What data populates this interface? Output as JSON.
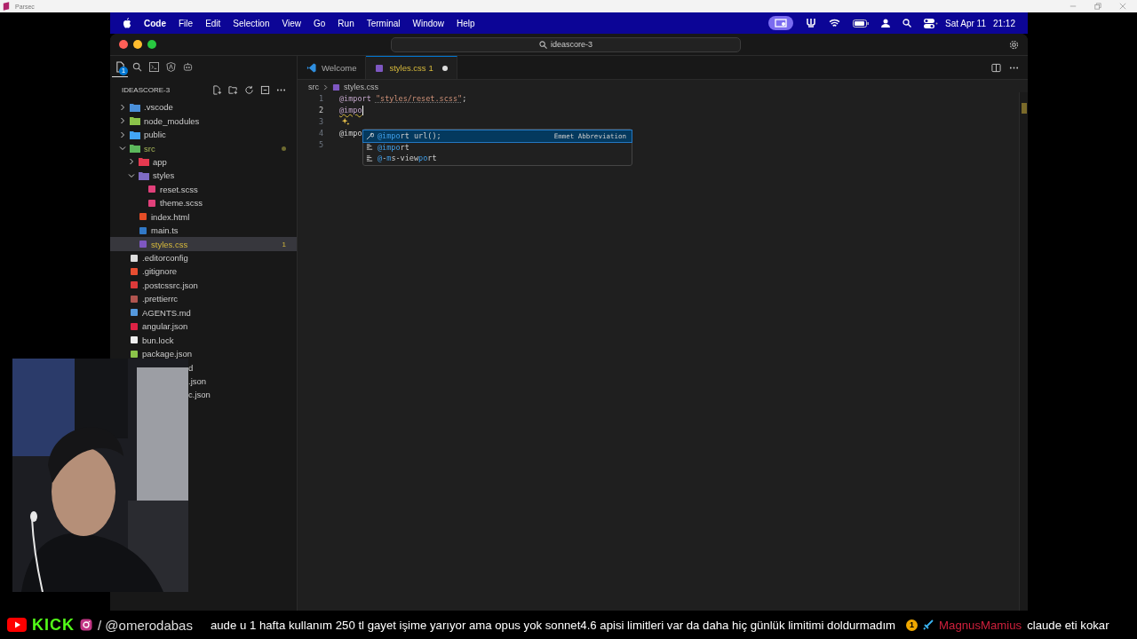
{
  "host_window": {
    "title": "Parsec"
  },
  "menu_bar": {
    "app": "Code",
    "menus": [
      "File",
      "Edit",
      "Selection",
      "View",
      "Go",
      "Run",
      "Terminal",
      "Window",
      "Help"
    ],
    "date": "Sat Apr 11",
    "time": "21:12"
  },
  "window": {
    "search": "ideascore-3"
  },
  "activity": [
    {
      "kind": "explorer",
      "selected": true,
      "badge": "1"
    },
    {
      "kind": "search",
      "selected": false
    },
    {
      "kind": "terminal",
      "selected": false
    },
    {
      "kind": "angular",
      "selected": false
    },
    {
      "kind": "robot",
      "selected": false
    }
  ],
  "explorer": {
    "title": "IDEASCORE-3",
    "tree": [
      {
        "name": ".vscode",
        "kind": "folder",
        "expanded": false,
        "selected": false,
        "color": "#4a8fd9"
      },
      {
        "name": "node_modules",
        "kind": "folder",
        "expanded": false,
        "selected": false,
        "color": "#8bc34a"
      },
      {
        "name": "public",
        "kind": "folder",
        "expanded": false,
        "selected": false,
        "color": "#42a5f5"
      },
      {
        "name": "src",
        "kind": "folder",
        "expanded": true,
        "selected": false,
        "color": "#5cb85c",
        "dot": true,
        "children": [
          {
            "name": "app",
            "kind": "folder",
            "expanded": false,
            "selected": false,
            "color": "#e53950"
          },
          {
            "name": "styles",
            "kind": "folder",
            "expanded": true,
            "selected": false,
            "color": "#7e6bc4",
            "children": [
              {
                "name": "reset.scss",
                "kind": "file",
                "selected": false,
                "color": "#e0407a"
              },
              {
                "name": "theme.scss",
                "kind": "file",
                "selected": false,
                "color": "#e0407a"
              }
            ]
          },
          {
            "name": "index.html",
            "kind": "file",
            "selected": false,
            "color": "#e44d26"
          },
          {
            "name": "main.ts",
            "kind": "file",
            "selected": false,
            "color": "#3178c6"
          },
          {
            "name": "styles.css",
            "kind": "file",
            "selected": true,
            "color": "#7e57c2",
            "warning": true,
            "badge": "1"
          }
        ]
      },
      {
        "name": ".editorconfig",
        "kind": "file",
        "selected": false,
        "color": "#dddddd"
      },
      {
        "name": ".gitignore",
        "kind": "file",
        "selected": false,
        "color": "#e84e31"
      },
      {
        "name": ".postcssrc.json",
        "kind": "file",
        "selected": false,
        "color": "#dd3a3a"
      },
      {
        "name": ".prettierrc",
        "kind": "file",
        "selected": false,
        "color": "#b0544f"
      },
      {
        "name": "AGENTS.md",
        "kind": "file",
        "selected": false,
        "color": "#5599dd"
      },
      {
        "name": "angular.json",
        "kind": "file",
        "selected": false,
        "color": "#dd2244"
      },
      {
        "name": "bun.lock",
        "kind": "file",
        "selected": false,
        "color": "#eeeeee"
      },
      {
        "name": "package.json",
        "kind": "file",
        "selected": false,
        "color": "#8bc34a"
      },
      {
        "name": "d",
        "kind": "partial",
        "selected": false
      },
      {
        "name": ".json",
        "kind": "partial",
        "selected": false
      },
      {
        "name": "c.json",
        "kind": "partial",
        "selected": false
      }
    ]
  },
  "tabs": [
    {
      "label": "Welcome",
      "kind": "welcome",
      "selected": false
    },
    {
      "label": "styles.css",
      "kind": "css",
      "selected": true,
      "problems": "1",
      "dirty": true
    }
  ],
  "breadcrumb": [
    "src",
    "styles.css"
  ],
  "code": [
    {
      "number": "1",
      "current": false,
      "segments": [
        {
          "text": "@import",
          "kind": "at"
        },
        {
          "text": "\"styles/reset.scss\"",
          "kind": "string"
        },
        {
          "text": ";",
          "kind": "plain"
        }
      ]
    },
    {
      "number": "2",
      "current": true,
      "cursor": true,
      "segments": [
        {
          "text": "@impo",
          "kind": "error"
        }
      ]
    },
    {
      "number": "3",
      "current": false,
      "sparkle": true
    },
    {
      "number": "4",
      "current": false,
      "segments": [
        {
          "text": "@impo",
          "kind": "plain"
        }
      ]
    },
    {
      "number": "5",
      "current": false
    }
  ],
  "suggestions": [
    {
      "label": "**@impo**rt url();",
      "kind": "emmet",
      "detail": "Emmet Abbreviation",
      "selected": true
    },
    {
      "label": "**@impo**rt",
      "kind": "property",
      "selected": false
    },
    {
      "label": "**@**-**m**s-view**po**rt",
      "kind": "property",
      "selected": false
    }
  ],
  "stream_bar": {
    "kick": "KICK",
    "handle": "/ @omerodabas",
    "message": "aude u 1 hafta kullanım 250 tl gayet işime yarıyor ama opus yok sonnet4.6 apisi limitleri var da daha hiç günlük limitimi doldurmadım",
    "badge": "1",
    "user": "MagnusMamius",
    "chat": "claude eti kokar"
  }
}
